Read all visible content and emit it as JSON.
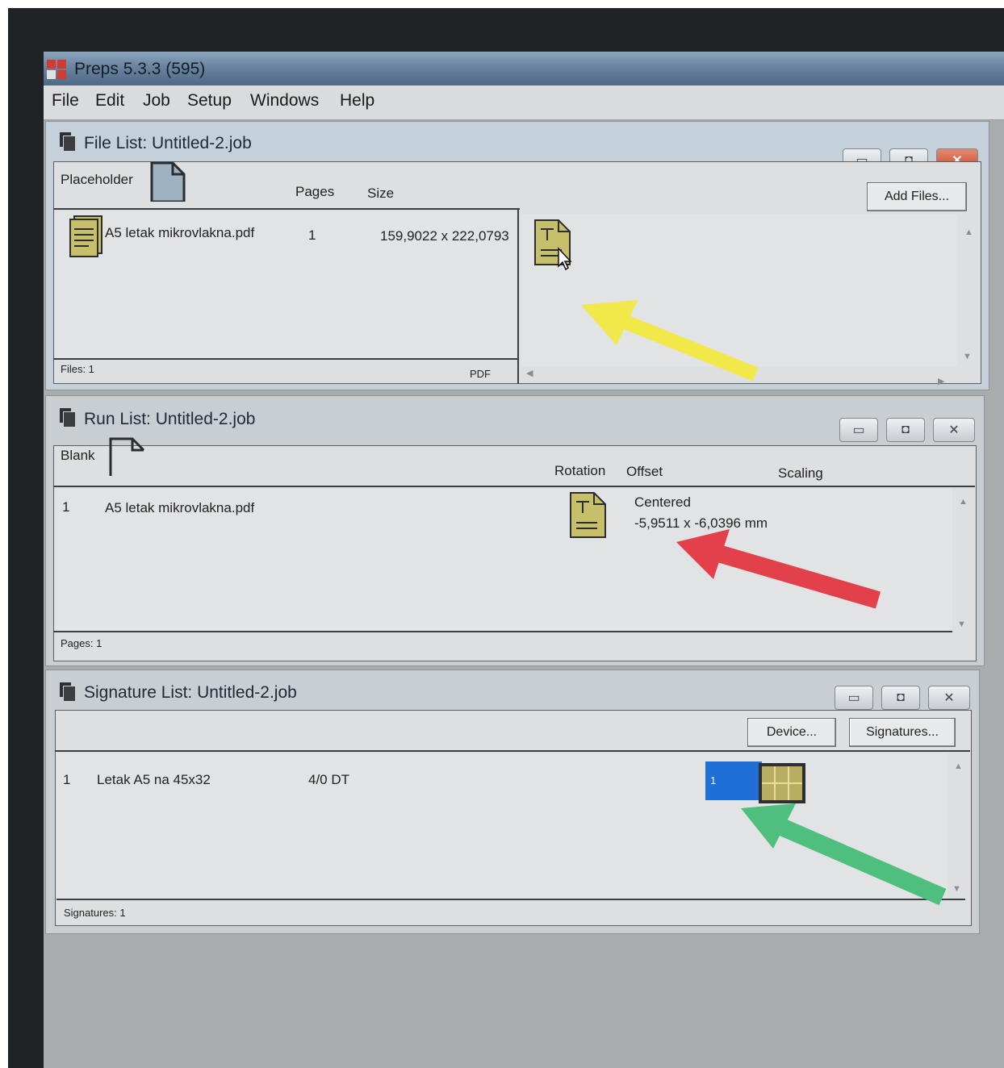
{
  "app": {
    "title": "Preps 5.3.3 (595)"
  },
  "menu": [
    "File",
    "Edit",
    "Job",
    "Setup",
    "Windows",
    "Help"
  ],
  "file_list": {
    "title": "File List:  Untitled-2.job",
    "placeholder_label": "Placeholder",
    "columns": {
      "pages": "Pages",
      "size": "Size"
    },
    "add_files_label": "Add Files...",
    "row": {
      "name": "A5 letak mikrovlakna.pdf",
      "pages": "1",
      "size": "159,9022 x 222,0793"
    },
    "status_count": "Files: 1",
    "status_type": "PDF"
  },
  "run_list": {
    "title": "Run List:  Untitled-2.job",
    "blank_label": "Blank",
    "columns": {
      "rotation": "Rotation",
      "offset": "Offset",
      "scaling": "Scaling"
    },
    "row": {
      "index": "1",
      "name": "A5 letak mikrovlakna.pdf",
      "offset_mode": "Centered",
      "offset_value": "-5,9511 x -6,0396 mm"
    },
    "status_count": "Pages: 1"
  },
  "signature_list": {
    "title": "Signature List:  Untitled-2.job",
    "device_label": "Device...",
    "signatures_label": "Signatures...",
    "row": {
      "index": "1",
      "name": "Letak A5 na 45x32",
      "colors": "4/0 DT",
      "thumb_number": "1"
    },
    "status_count": "Signatures: 1"
  },
  "colors": {
    "arrow_yellow": "#f1e84a",
    "arrow_red": "#e2414b",
    "arrow_green": "#4fbf7e",
    "selection_blue": "#1f6fd6",
    "doc_icon": "#c8bf6a"
  },
  "icons": [
    "app-logo-icon",
    "document-stack-icon",
    "pdf-file-icon",
    "page-drop-icon",
    "cursor-icon",
    "placeholder-page-icon",
    "blank-page-icon",
    "signature-grid-icon",
    "minimize-icon",
    "maximize-icon",
    "close-icon"
  ]
}
